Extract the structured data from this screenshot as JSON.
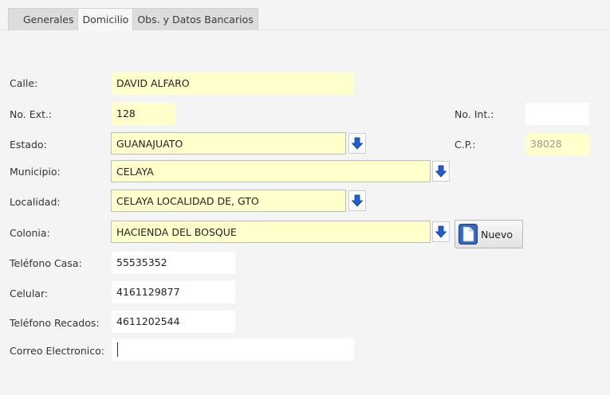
{
  "tabs": [
    {
      "label": "Generales"
    },
    {
      "label": "Domicilio"
    },
    {
      "label": "Obs. y Datos Bancarios"
    }
  ],
  "form": {
    "calle": {
      "label": "Calle:",
      "value": "DAVID ALFARO"
    },
    "no_ext": {
      "label": "No. Ext.:",
      "value": "128"
    },
    "no_int": {
      "label": "No. Int.:",
      "value": ""
    },
    "estado": {
      "label": "Estado:",
      "value": "GUANAJUATO"
    },
    "cp": {
      "label": "C.P.:",
      "value": "38028"
    },
    "municipio": {
      "label": "Municipio:",
      "value": "CELAYA"
    },
    "localidad": {
      "label": "Localidad:",
      "value": "CELAYA LOCALIDAD DE, GTO"
    },
    "colonia": {
      "label": "Colonia:",
      "value": "HACIENDA DEL BOSQUE"
    },
    "telefono_casa": {
      "label": "Teléfono Casa:",
      "value": "55535352"
    },
    "celular": {
      "label": "Celular:",
      "value": "4161129877"
    },
    "telefono_recados": {
      "label": "Teléfono Recados:",
      "value": "4611202544"
    },
    "correo": {
      "label": "Correo Electronico:",
      "value": ""
    }
  },
  "buttons": {
    "nuevo": "Nuevo"
  },
  "colors": {
    "field_yellow": "#ffffcc",
    "arrow_blue": "#1f5fd6"
  }
}
